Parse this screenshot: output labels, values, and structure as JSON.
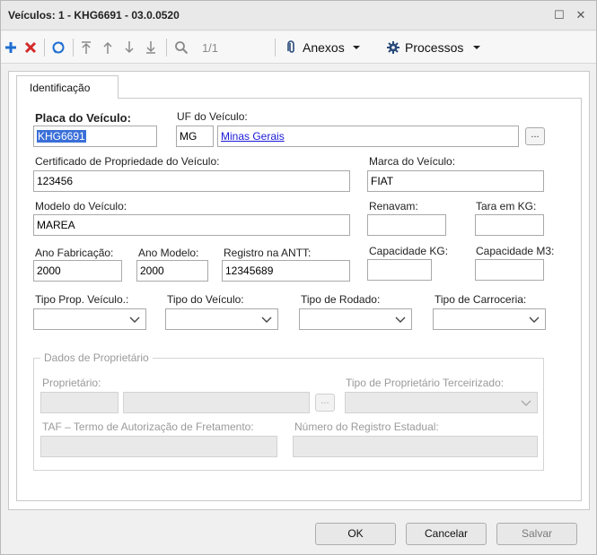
{
  "window": {
    "title": "Veículos: 1 - KHG6691 - 03.0.0520"
  },
  "toolbar": {
    "pagination": "1/1",
    "attachments_label": "Anexos",
    "processes_label": "Processos"
  },
  "tabs": [
    {
      "label": "Identificação"
    }
  ],
  "form": {
    "plate": {
      "label": "Placa do Veículo:",
      "value": "KHG6691"
    },
    "uf": {
      "label": "UF do Veículo:",
      "code": "MG",
      "name": "Minas Gerais",
      "lookup": "..."
    },
    "certificate": {
      "label": "Certificado de Propriedade do Veículo:",
      "value": "123456"
    },
    "brand": {
      "label": "Marca do Veículo:",
      "value": "FIAT"
    },
    "model": {
      "label": "Modelo do Veículo:",
      "value": "MAREA"
    },
    "renavam": {
      "label": "Renavam:",
      "value": ""
    },
    "tare": {
      "label": "Tara em KG:",
      "value": ""
    },
    "year_manufacture": {
      "label": "Ano Fabricação:",
      "value": "2000"
    },
    "year_model": {
      "label": "Ano Modelo:",
      "value": "2000"
    },
    "antt": {
      "label": "Registro na ANTT:",
      "value": "12345689"
    },
    "capacity_kg": {
      "label": "Capacidade KG:",
      "value": ""
    },
    "capacity_m3": {
      "label": "Capacidade M3:",
      "value": ""
    },
    "owner_type": {
      "label": "Tipo Prop. Veículo.:",
      "value": ""
    },
    "vehicle_type": {
      "label": "Tipo do Veículo:",
      "value": ""
    },
    "wheel_type": {
      "label": "Tipo de Rodado:",
      "value": ""
    },
    "body_type": {
      "label": "Tipo de Carroceria:",
      "value": ""
    }
  },
  "owner_section": {
    "legend": "Dados de Proprietário",
    "owner_label": "Proprietário:",
    "owner_lookup": "...",
    "third_party_type_label": "Tipo de Proprietário Terceirizado:",
    "taf_label": "TAF – Termo de Autorização de Fretamento:",
    "state_reg_label": "Número do Registro Estadual:"
  },
  "footer": {
    "ok": "OK",
    "cancel": "Cancelar",
    "save": "Salvar"
  },
  "colors": {
    "add": "#1f6fd1",
    "delete": "#d42a2a",
    "refresh": "#1f6fd1",
    "selection": "#3a6fd8",
    "link": "#1a1ad6"
  }
}
